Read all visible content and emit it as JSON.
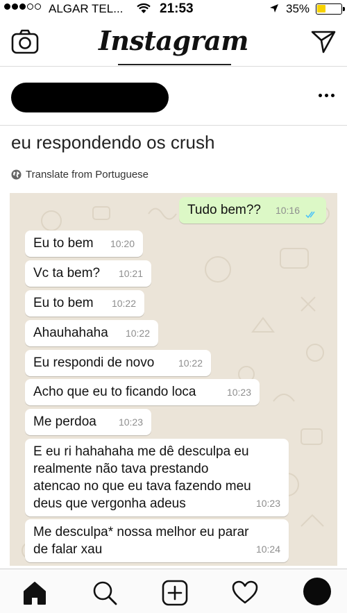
{
  "status_bar": {
    "carrier": "ALGAR TEL...",
    "time": "21:53",
    "battery": "35%",
    "battery_level": 0.35
  },
  "header": {
    "logo": "Instagram",
    "icons": [
      "camera-icon",
      "send-icon"
    ]
  },
  "post": {
    "caption": "eu respondendo os crush",
    "translate": "Translate from Portuguese",
    "more_icon": "more-options-icon"
  },
  "chat": {
    "messages": [
      {
        "text": "Tudo bem??",
        "time": "10:16",
        "outgoing": true
      },
      {
        "text": "Eu to bem",
        "time": "10:20",
        "outgoing": false
      },
      {
        "text": "Vc ta bem?",
        "time": "10:21",
        "outgoing": false
      },
      {
        "text": "Eu to bem",
        "time": "10:22",
        "outgoing": false
      },
      {
        "text": "Ahauhahaha",
        "time": "10:22",
        "outgoing": false
      },
      {
        "text": "Eu respondi de novo",
        "time": "10:22",
        "outgoing": false
      },
      {
        "text": "Acho que eu to ficando loca",
        "time": "10:23",
        "outgoing": false
      },
      {
        "text": "Me perdoa",
        "time": "10:23",
        "outgoing": false
      },
      {
        "text": "E eu ri hahahaha me dê desculpa eu\nrealmente não tava prestando\natencao no que eu tava fazendo meu\ndeus que vergonha adeus",
        "time": "10:23",
        "outgoing": false
      },
      {
        "text": "Me desculpa* nossa melhor eu parar\nde falar xau",
        "time": "10:24",
        "outgoing": false
      }
    ]
  },
  "nav": {
    "items": [
      "home-icon",
      "search-icon",
      "add-post-icon",
      "heart-icon",
      "profile-avatar"
    ]
  }
}
